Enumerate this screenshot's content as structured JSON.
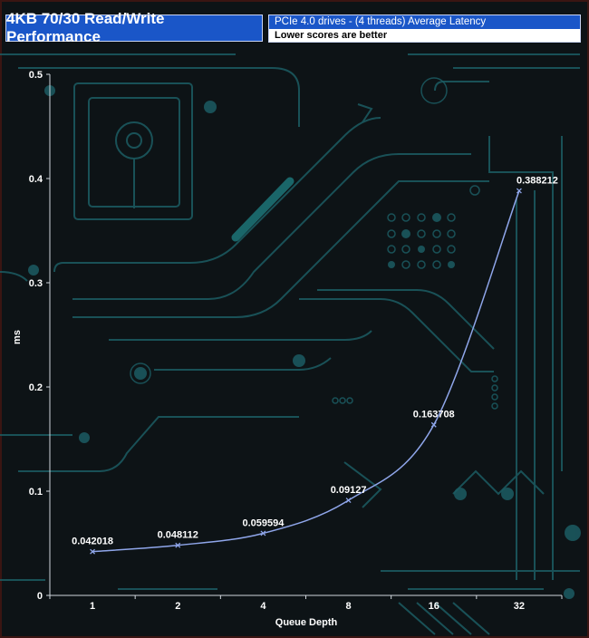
{
  "header": {
    "title": "4KB 70/30 Read/Write Performance",
    "subtitle_line1": "PCIe 4.0 drives - (4 threads) Average Latency",
    "subtitle_line2": "Lower scores are better"
  },
  "colors": {
    "background": "#0d1316",
    "circuit": "#1c5c63",
    "series": "#8fa6ea",
    "text": "#ffffff",
    "title_bg": "#1a56c8"
  },
  "chart_data": {
    "type": "line",
    "title": "4KB 70/30 Read/Write Performance",
    "subtitle": "PCIe 4.0 drives - (4 threads) Average Latency",
    "note": "Lower scores are better",
    "xlabel": "Queue Depth",
    "ylabel": "ms",
    "categories": [
      "1",
      "2",
      "4",
      "8",
      "16",
      "32"
    ],
    "series": [
      {
        "values": [
          0.042018,
          0.048112,
          0.059594,
          0.09127,
          0.163708,
          0.388212
        ]
      }
    ],
    "data_labels": [
      "0.042018",
      "0.048112",
      "0.059594",
      "0.09127",
      "0.163708",
      "0.388212"
    ],
    "ylim": [
      0,
      0.5
    ],
    "yticks": [
      "0",
      "0.1",
      "0.2",
      "0.3",
      "0.4",
      "0.5"
    ],
    "legend": "none",
    "grid": false
  }
}
